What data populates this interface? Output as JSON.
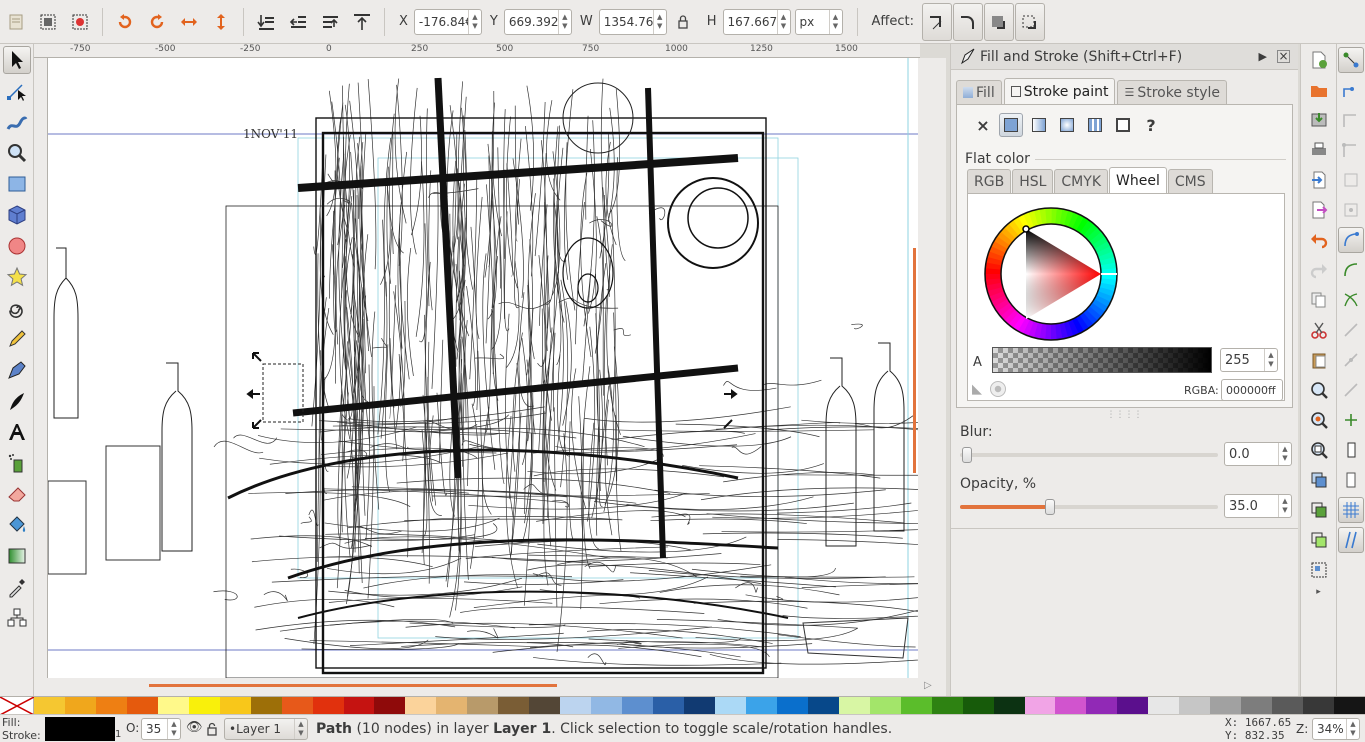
{
  "toolbar": {
    "x_label": "X",
    "x_value": "-176.84€",
    "y_label": "Y",
    "y_value": "669.392",
    "w_label": "W",
    "w_value": "1354.76",
    "h_label": "H",
    "h_value": "167.667",
    "unit": "px",
    "affect_label": "Affect:"
  },
  "ruler": {
    "ticks": [
      "-750",
      "-500",
      "-250",
      "0",
      "250",
      "500",
      "750",
      "1000",
      "1250",
      "1500"
    ]
  },
  "canvas": {
    "sketch_text": "1NOV'11"
  },
  "dialog": {
    "title": "Fill and Stroke (Shift+Ctrl+F)",
    "tabs": [
      "Fill",
      "Stroke paint",
      "Stroke style"
    ],
    "paint_mode_unset": "×",
    "paint_mode_unknown": "?",
    "flat_color_label": "Flat color",
    "color_tabs": [
      "RGB",
      "HSL",
      "CMYK",
      "Wheel",
      "CMS"
    ],
    "alpha_label": "A",
    "alpha_value": "255",
    "rgba_label": "RGBA:",
    "rgba_value": "000000ff",
    "blur_label": "Blur:",
    "blur_value": "0.0",
    "opacity_label": "Opacity, %",
    "opacity_value": "35.0",
    "opacity_fraction": 0.35
  },
  "palette": {
    "colors": [
      "#f5c731",
      "#f0a71c",
      "#ee7f13",
      "#e55a0d",
      "#fff98a",
      "#f9f00b",
      "#f8c71a",
      "#9d6f08",
      "#e7591a",
      "#e1310d",
      "#c51311",
      "#8f0a0a",
      "#fbd39b",
      "#e4b470",
      "#b89a6a",
      "#7a5d35",
      "#534636",
      "#bcd4ef",
      "#91b8e4",
      "#5d8fcf",
      "#2a5fa7",
      "#113a72",
      "#abd9f6",
      "#3ba3e9",
      "#0a6fcc",
      "#07488a",
      "#d8f6a4",
      "#a3e56a",
      "#5bbd2b",
      "#2e8212",
      "#175b0a",
      "#0c3212",
      "#f1a4e6",
      "#d154ce",
      "#9129b6",
      "#5b0f8d",
      "#e7e7e7",
      "#c6c6c6",
      "#a1a1a1",
      "#7d7d7d",
      "#5a5a5a",
      "#383838",
      "#151515"
    ]
  },
  "status": {
    "fill_label": "Fill:",
    "stroke_label": "Stroke:",
    "stroke_width": "1",
    "opacity_label": "O:",
    "opacity_value": "35",
    "layer": "•Layer 1",
    "message_object": "Path",
    "message_nodes": " (10 nodes) in layer ",
    "message_layer": "Layer 1",
    "message_rest": ". Click selection to toggle scale/rotation handles.",
    "x_label": "X:",
    "x_value": "1667.65",
    "y_label": "Y:",
    "y_value": "832.35",
    "zoom_label": "Z:",
    "zoom_value": "34%"
  }
}
